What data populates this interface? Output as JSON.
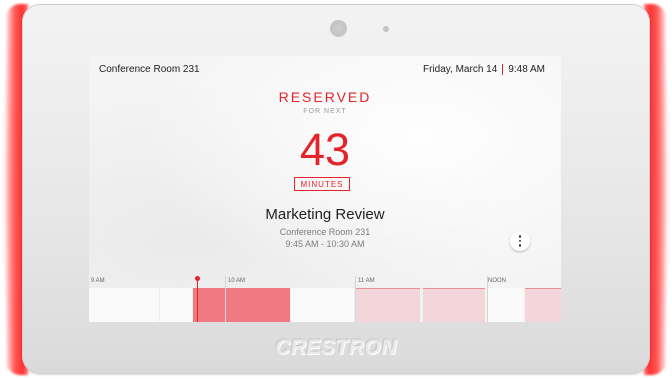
{
  "screen": {
    "room_name": "Conference Room 231",
    "date": "Friday, March 14",
    "time": "9:48 AM"
  },
  "status": {
    "label": "RESERVED",
    "sublabel": "FOR NEXT",
    "count": "43",
    "unit": "MINUTES"
  },
  "meeting": {
    "title": "Marketing Review",
    "room": "Conference Room 231",
    "time_range": "9:45 AM - 10:30 AM"
  },
  "timeline": {
    "labels": [
      "9 AM",
      "10 AM",
      "11 AM",
      "NOON"
    ]
  },
  "device": {
    "brand": "CRESTRON"
  },
  "colors": {
    "accent": "#e5232a",
    "led_glow": "#ff2f2f"
  },
  "icons": [
    "more-vertical-icon",
    "camera-icon",
    "sensor-icon"
  ]
}
